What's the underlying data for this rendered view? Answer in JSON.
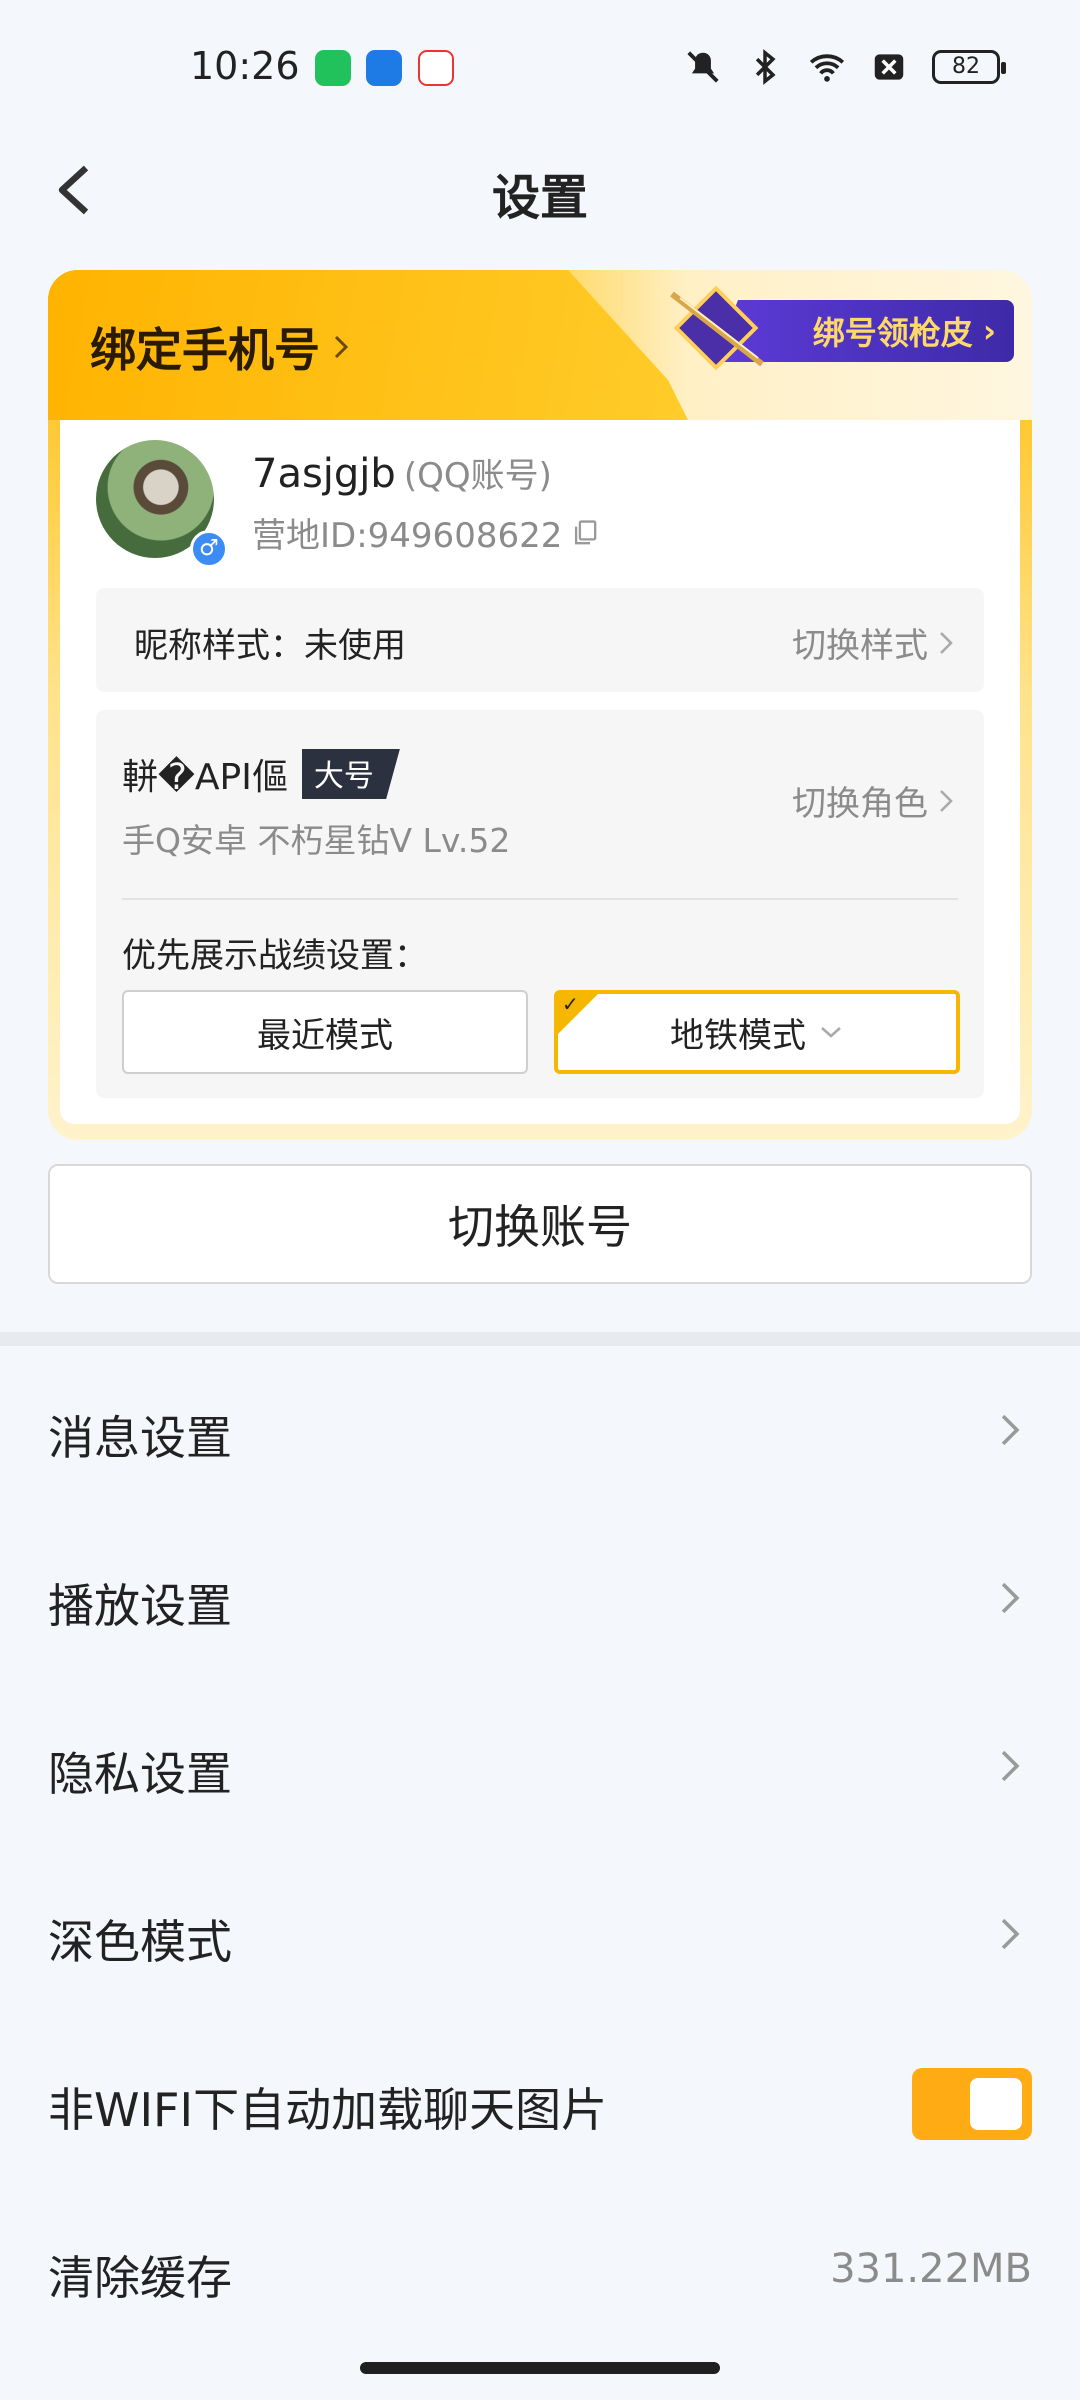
{
  "status_bar": {
    "time": "10:26",
    "battery": "82"
  },
  "nav": {
    "title": "设置"
  },
  "account_card": {
    "bind_phone_label": "绑定手机号",
    "promo_label": "绑号领枪皮",
    "username": "7asjgjb",
    "account_type": "(QQ账号)",
    "camp_id": "营地ID:949608622",
    "nickname_style_label": "昵称样式：未使用",
    "switch_style_label": "切换样式",
    "role_name": "軿�API傴",
    "main_account_badge": "大号",
    "role_info": "手Q安卓  不朽星钻V  Lv.52",
    "switch_role_label": "切换角色",
    "record_pref_label": "优先展示战绩设置：",
    "modes": {
      "recent": "最近模式",
      "metro": "地铁模式",
      "selected": "metro"
    }
  },
  "switch_account_label": "切换账号",
  "settings": {
    "message": "消息设置",
    "playback": "播放设置",
    "privacy": "隐私设置",
    "dark_mode": "深色模式",
    "auto_load_images": "非WIFI下自动加载聊天图片",
    "auto_load_images_on": true,
    "clear_cache": "清除缓存",
    "cache_size": "331.22MB"
  },
  "colors": {
    "accent": "#ffab14",
    "background": "#f4f7fb",
    "secondary_text": "#8b8b8b"
  }
}
